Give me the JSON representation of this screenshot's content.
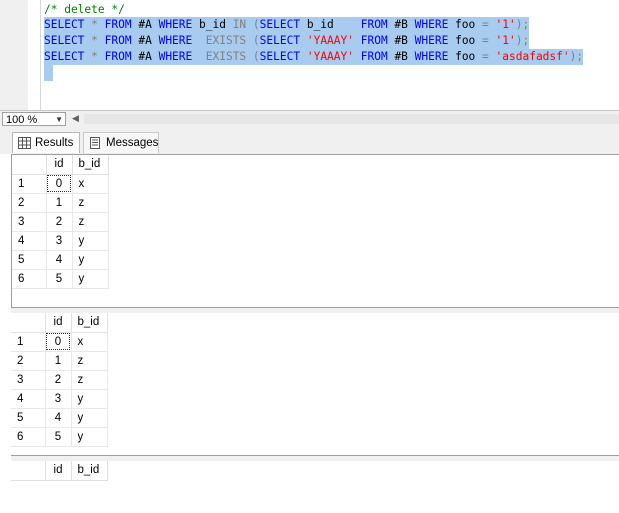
{
  "editor": {
    "comment_line": "/* delete */",
    "lines": [
      [
        "SELECT",
        " ",
        "*",
        " ",
        "FROM",
        " #A ",
        "WHERE",
        " b_id ",
        "IN",
        " ",
        "(",
        "SELECT",
        " b_id    ",
        "FROM",
        " #B ",
        "WHERE",
        " foo ",
        "=",
        " ",
        "'1'",
        ")",
        ";"
      ],
      [
        "SELECT",
        " ",
        "*",
        " ",
        "FROM",
        " #A ",
        "WHERE",
        "  ",
        "EXISTS",
        " ",
        "(",
        "SELECT",
        " ",
        "'YAAAY'",
        " ",
        "FROM",
        " #B ",
        "WHERE",
        " foo ",
        "=",
        " ",
        "'1'",
        ")",
        ";"
      ],
      [
        "SELECT",
        " ",
        "*",
        " ",
        "FROM",
        " #A ",
        "WHERE",
        "  ",
        "EXISTS",
        " ",
        "(",
        "SELECT",
        " ",
        "'YAAAY'",
        " ",
        "FROM",
        " #B ",
        "WHERE",
        " foo ",
        "=",
        " ",
        "'asdafadsf'",
        ")",
        ";"
      ]
    ],
    "line_classes": [
      [
        "kw",
        "tx",
        "op",
        "tx",
        "kw",
        "tx",
        "kw",
        "tx",
        "op",
        "tx",
        "op",
        "kw",
        "tx",
        "kw",
        "tx",
        "kw",
        "tx",
        "op",
        "tx",
        "str",
        "op",
        "op"
      ],
      [
        "kw",
        "tx",
        "op",
        "tx",
        "kw",
        "tx",
        "kw",
        "tx",
        "op",
        "tx",
        "op",
        "kw",
        "tx",
        "str",
        "tx",
        "kw",
        "tx",
        "kw",
        "tx",
        "op",
        "tx",
        "str",
        "op",
        "op"
      ],
      [
        "kw",
        "tx",
        "op",
        "tx",
        "kw",
        "tx",
        "kw",
        "tx",
        "op",
        "tx",
        "op",
        "kw",
        "tx",
        "str",
        "tx",
        "kw",
        "tx",
        "kw",
        "tx",
        "op",
        "tx",
        "str",
        "op",
        "op"
      ]
    ]
  },
  "zoom": {
    "value": "100 %"
  },
  "tabs": {
    "results": "Results",
    "messages": "Messages"
  },
  "grids": [
    {
      "columns": [
        "id",
        "b_id"
      ],
      "rows": [
        [
          "1",
          "0",
          "x"
        ],
        [
          "2",
          "1",
          "z"
        ],
        [
          "3",
          "2",
          "z"
        ],
        [
          "4",
          "3",
          "y"
        ],
        [
          "5",
          "4",
          "y"
        ],
        [
          "6",
          "5",
          "y"
        ]
      ]
    },
    {
      "columns": [
        "id",
        "b_id"
      ],
      "rows": [
        [
          "1",
          "0",
          "x"
        ],
        [
          "2",
          "1",
          "z"
        ],
        [
          "3",
          "2",
          "z"
        ],
        [
          "4",
          "3",
          "y"
        ],
        [
          "5",
          "4",
          "y"
        ],
        [
          "6",
          "5",
          "y"
        ]
      ]
    },
    {
      "columns": [
        "id",
        "b_id"
      ],
      "rows": []
    }
  ],
  "colors": {
    "selection": "#a8cbf0",
    "keyword": "#0000ff",
    "string": "#ff0000",
    "comment": "#008000",
    "operator": "#808080"
  }
}
